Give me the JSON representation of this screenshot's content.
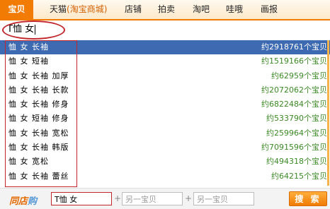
{
  "tabs": [
    {
      "label": "宝贝",
      "active": true
    },
    {
      "label": "天猫",
      "sub": "(淘宝商城)"
    },
    {
      "label": "店铺"
    },
    {
      "label": "拍卖"
    },
    {
      "label": "淘吧"
    },
    {
      "label": "哇哦"
    },
    {
      "label": "画报"
    }
  ],
  "search": {
    "query": "T恤 女"
  },
  "suggestions": [
    {
      "keyword": "恤 女 长袖",
      "count": "约2918761个宝贝",
      "highlighted": true
    },
    {
      "keyword": "恤 女 短袖",
      "count": "约1519166个宝贝"
    },
    {
      "keyword": "恤 女 长袖 加厚",
      "count": "约62959个宝贝"
    },
    {
      "keyword": "恤 女 长袖 长款",
      "count": "约2072062个宝贝"
    },
    {
      "keyword": "恤 女 长袖 修身",
      "count": "约6822484个宝贝"
    },
    {
      "keyword": "恤 女 短袖 修身",
      "count": "约533790个宝贝"
    },
    {
      "keyword": "恤 女 长袖 宽松",
      "count": "约259964个宝贝"
    },
    {
      "keyword": "恤 女 长袖 韩版",
      "count": "约7091596个宝贝"
    },
    {
      "keyword": "恤 女 宽松",
      "count": "约494318个宝贝"
    },
    {
      "keyword": "恤 女 长袖 蕾丝",
      "count": "约64215个宝贝"
    }
  ],
  "bottom": {
    "logo_a": "同店",
    "logo_b": "购",
    "field1": "T恤 女",
    "field2_placeholder": "另一宝贝",
    "field3_placeholder": "另一宝贝",
    "plus": "+",
    "search_button": "搜 索"
  },
  "colors": {
    "accent": "#f27b04",
    "highlight": "#3d6ab0",
    "count_green": "#3c8a26",
    "annotation_red": "#c1272d"
  }
}
